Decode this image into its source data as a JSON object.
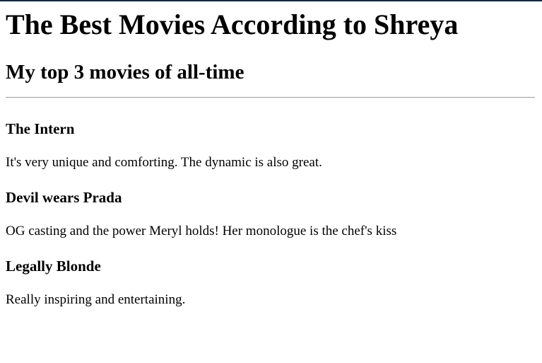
{
  "page": {
    "title": "The Best Movies According to Shreya",
    "subtitle": "My top 3 movies of all-time"
  },
  "movies": [
    {
      "title": "The Intern",
      "description": "It's very unique and comforting. The dynamic is also great."
    },
    {
      "title": "Devil wears Prada",
      "description": "OG casting and the power Meryl holds! Her monologue is the chef's kiss"
    },
    {
      "title": "Legally Blonde",
      "description": "Really inspiring and entertaining."
    }
  ]
}
